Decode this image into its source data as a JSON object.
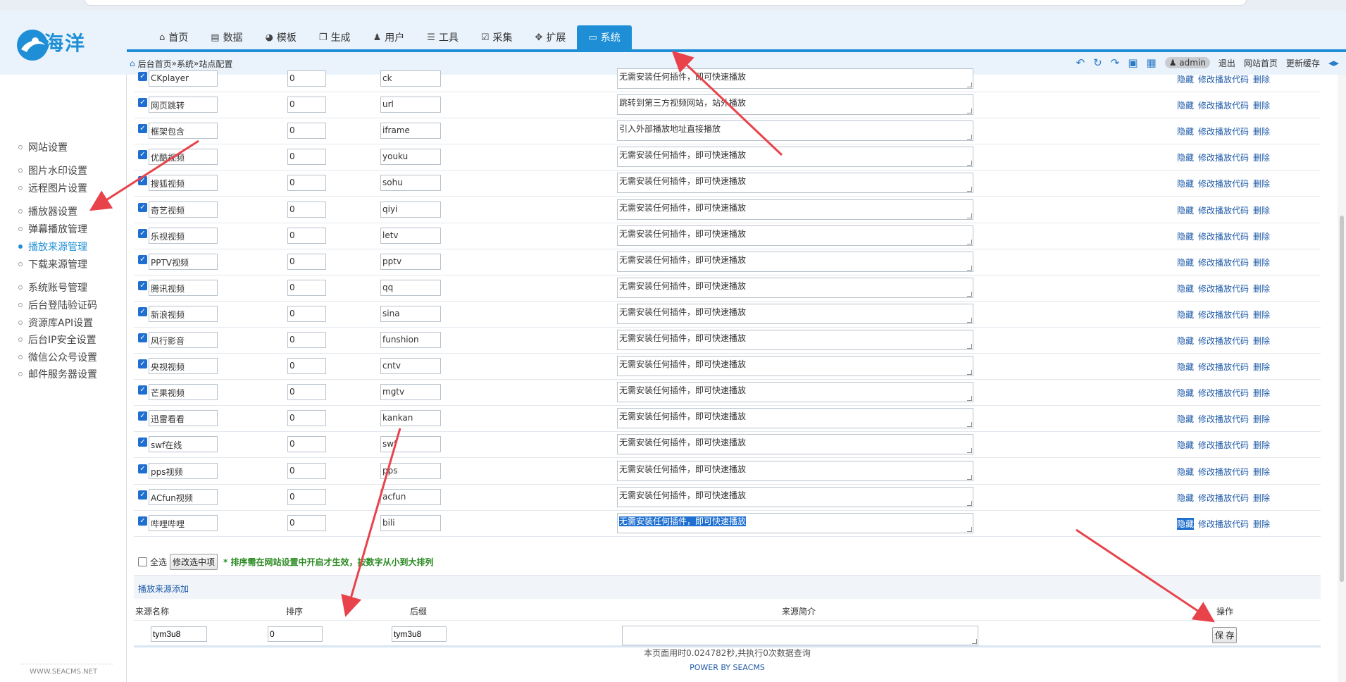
{
  "header": {
    "logo_text": "海洋",
    "nav": [
      {
        "label": "首页",
        "icon": "home-icon",
        "glyph": "⌂"
      },
      {
        "label": "数据",
        "icon": "database-icon",
        "glyph": "▤"
      },
      {
        "label": "模板",
        "icon": "palette-icon",
        "glyph": "◕"
      },
      {
        "label": "生成",
        "icon": "copy-icon",
        "glyph": "❐"
      },
      {
        "label": "用户",
        "icon": "user-icon",
        "glyph": "♟"
      },
      {
        "label": "工具",
        "icon": "tools-icon",
        "glyph": "☰"
      },
      {
        "label": "采集",
        "icon": "collect-icon",
        "glyph": "☑"
      },
      {
        "label": "扩展",
        "icon": "extend-icon",
        "glyph": "✥"
      },
      {
        "label": "系统",
        "icon": "monitor-icon",
        "glyph": "▭"
      }
    ],
    "active_nav": "系统",
    "breadcrumb": {
      "home": "后台首页",
      "sep": " » ",
      "system": "系统",
      "page": "站点配置"
    },
    "user": "admin",
    "links": {
      "logout": "退出",
      "site_home": "网站首页",
      "update_cache": "更新缓存"
    }
  },
  "sidebar": {
    "items": [
      {
        "label": "网站设置",
        "active": false
      },
      {
        "label": "图片水印设置",
        "active": false
      },
      {
        "label": "远程图片设置",
        "active": false
      },
      {
        "label": "播放器设置",
        "active": false
      },
      {
        "label": "弹幕播放管理",
        "active": false
      },
      {
        "label": "播放来源管理",
        "active": true
      },
      {
        "label": "下载来源管理",
        "active": false
      },
      {
        "label": "系统账号管理",
        "active": false
      },
      {
        "label": "后台登陆验证码",
        "active": false
      },
      {
        "label": "资源库API设置",
        "active": false
      },
      {
        "label": "后台IP安全设置",
        "active": false
      },
      {
        "label": "微信公众号设置",
        "active": false
      },
      {
        "label": "邮件服务器设置",
        "active": false
      }
    ],
    "footer": "WWW.SEACMS.NET"
  },
  "player_sources": [
    {
      "name": "CKplayer",
      "sort": "0",
      "suffix": "ck",
      "desc": "无需安装任何插件，即可快速播放"
    },
    {
      "name": "网页跳转",
      "sort": "0",
      "suffix": "url",
      "desc": "跳转到第三方视频网站，站外播放"
    },
    {
      "name": "框架包含",
      "sort": "0",
      "suffix": "iframe",
      "desc": "引入外部播放地址直接播放"
    },
    {
      "name": "优酷视频",
      "sort": "0",
      "suffix": "youku",
      "desc": "无需安装任何插件，即可快速播放"
    },
    {
      "name": "搜狐视频",
      "sort": "0",
      "suffix": "sohu",
      "desc": "无需安装任何插件，即可快速播放"
    },
    {
      "name": "奇艺视频",
      "sort": "0",
      "suffix": "qiyi",
      "desc": "无需安装任何插件，即可快速播放"
    },
    {
      "name": "乐视视频",
      "sort": "0",
      "suffix": "letv",
      "desc": "无需安装任何插件，即可快速播放"
    },
    {
      "name": "PPTV视频",
      "sort": "0",
      "suffix": "pptv",
      "desc": "无需安装任何插件，即可快速播放"
    },
    {
      "name": "腾讯视频",
      "sort": "0",
      "suffix": "qq",
      "desc": "无需安装任何插件，即可快速播放"
    },
    {
      "name": "新浪视频",
      "sort": "0",
      "suffix": "sina",
      "desc": "无需安装任何插件，即可快速播放"
    },
    {
      "name": "风行影音",
      "sort": "0",
      "suffix": "funshion",
      "desc": "无需安装任何插件，即可快速播放"
    },
    {
      "name": "央视视频",
      "sort": "0",
      "suffix": "cntv",
      "desc": "无需安装任何插件，即可快速播放"
    },
    {
      "name": "芒果视频",
      "sort": "0",
      "suffix": "mgtv",
      "desc": "无需安装任何插件，即可快速播放"
    },
    {
      "name": "迅雷看看",
      "sort": "0",
      "suffix": "kankan",
      "desc": "无需安装任何插件，即可快速播放"
    },
    {
      "name": "swf在线",
      "sort": "0",
      "suffix": "swf",
      "desc": "无需安装任何插件，即可快速播放"
    },
    {
      "name": "pps视频",
      "sort": "0",
      "suffix": "pps",
      "desc": "无需安装任何插件，即可快速播放"
    },
    {
      "name": "ACfun视频",
      "sort": "0",
      "suffix": "acfun",
      "desc": "无需安装任何插件，即可快速播放"
    },
    {
      "name": "哔哩哔哩",
      "sort": "0",
      "suffix": "bili",
      "desc": "无需安装任何插件，即可快速播放",
      "selected": true
    }
  ],
  "row_ops": {
    "hide": "隐藏",
    "edit_code": "修改播放代码",
    "delete": "删除"
  },
  "bulk": {
    "select_all": "全选",
    "edit_selected": "修改选中项",
    "note": "* 排序需在网站设置中开启才生效，按数字从小到大排列"
  },
  "add_section": {
    "title": "播放来源添加",
    "headers": {
      "name": "来源名称",
      "sort": "排序",
      "suffix": "后缀",
      "desc": "来源简介",
      "ops": "操作"
    },
    "values": {
      "name": "tym3u8",
      "sort": "0",
      "suffix": "tym3u8",
      "desc": ""
    },
    "save": "保 存"
  },
  "footer": {
    "timing": "本页面用时0.024782秒,共执行0次数据查询",
    "power": "POWER BY SEACMS"
  },
  "colors": {
    "accent": "#1e8fd6",
    "link": "#1e5aa8",
    "note": "#2a8a22",
    "arrow": "#e8434b"
  }
}
